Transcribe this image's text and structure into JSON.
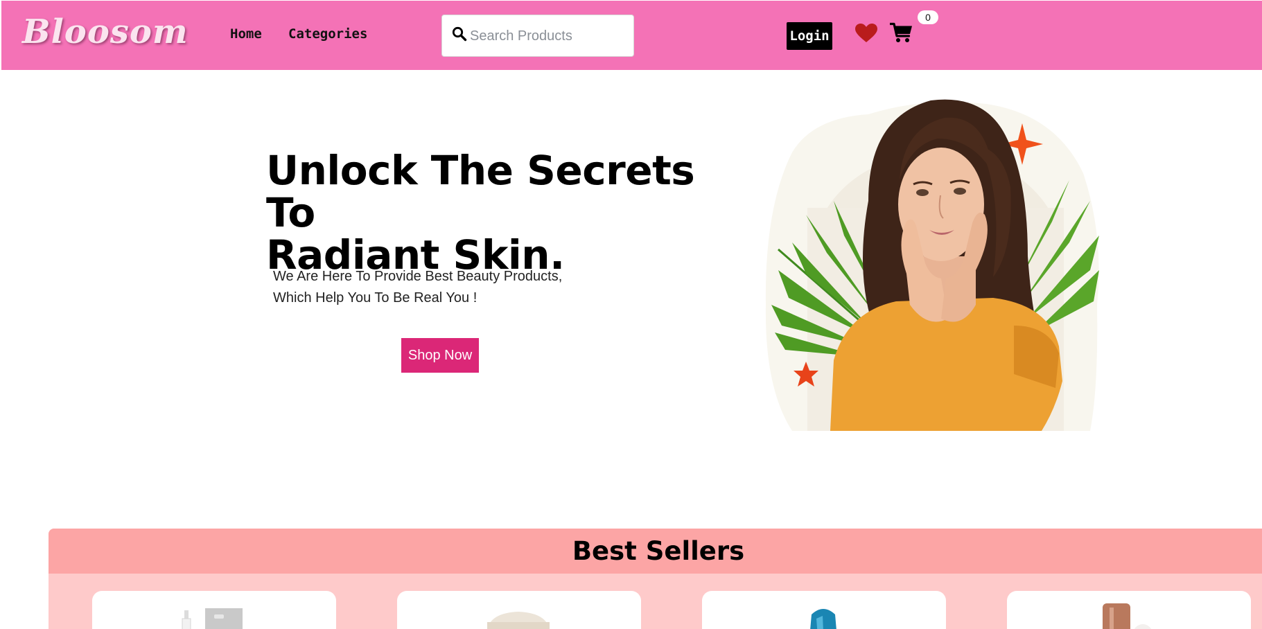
{
  "header": {
    "logo_text": "Bloosom",
    "nav": {
      "home": "Home",
      "categories": "Categories"
    },
    "search": {
      "placeholder": "Search Products",
      "value": ""
    },
    "login_label": "Login",
    "cart_count": "0",
    "icons": {
      "search": "search-icon",
      "wishlist": "heart-icon",
      "cart": "cart-icon"
    },
    "colors": {
      "navbar_bg": "#f472b6",
      "heart": "#b91c1c"
    }
  },
  "hero": {
    "title_line1": "Unlock The Secrets To",
    "title_line2": "Radiant Skin.",
    "desc_line1": "We Are Here To Provide Best Beauty Products,",
    "desc_line2": "Which Help You To Be Real You !",
    "cta_label": "Shop Now",
    "cta_color": "#db2777"
  },
  "best_sellers": {
    "title": "Best Sellers",
    "header_bg": "#fca5a5",
    "section_bg": "#fecaca"
  }
}
